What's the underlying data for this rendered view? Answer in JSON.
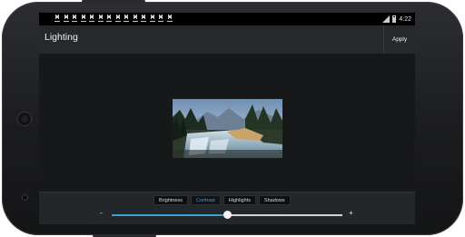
{
  "statusbar": {
    "notifications": [
      "download-icon",
      "download-icon",
      "download-icon",
      "download-icon",
      "download-icon",
      "download-icon",
      "download-icon",
      "download-icon",
      "download-icon",
      "download-icon",
      "download-icon",
      "download-icon",
      "download-icon",
      "download-icon"
    ],
    "time": "4:22"
  },
  "actionbar": {
    "title": "Lighting",
    "apply_label": "Apply"
  },
  "photo": {
    "description_icon": "landscape-photo"
  },
  "adjust": {
    "tabs": [
      {
        "label": "Brightness"
      },
      {
        "label": "Contrast"
      },
      {
        "label": "Highlights"
      },
      {
        "label": "Shadows"
      }
    ],
    "active_tab": "Contrast",
    "minus": "-",
    "plus": "+",
    "slider_value": 0.5
  },
  "colors": {
    "accent": "#3aa0d8",
    "actionbar": "#26292c",
    "canvas": "#16181a"
  }
}
